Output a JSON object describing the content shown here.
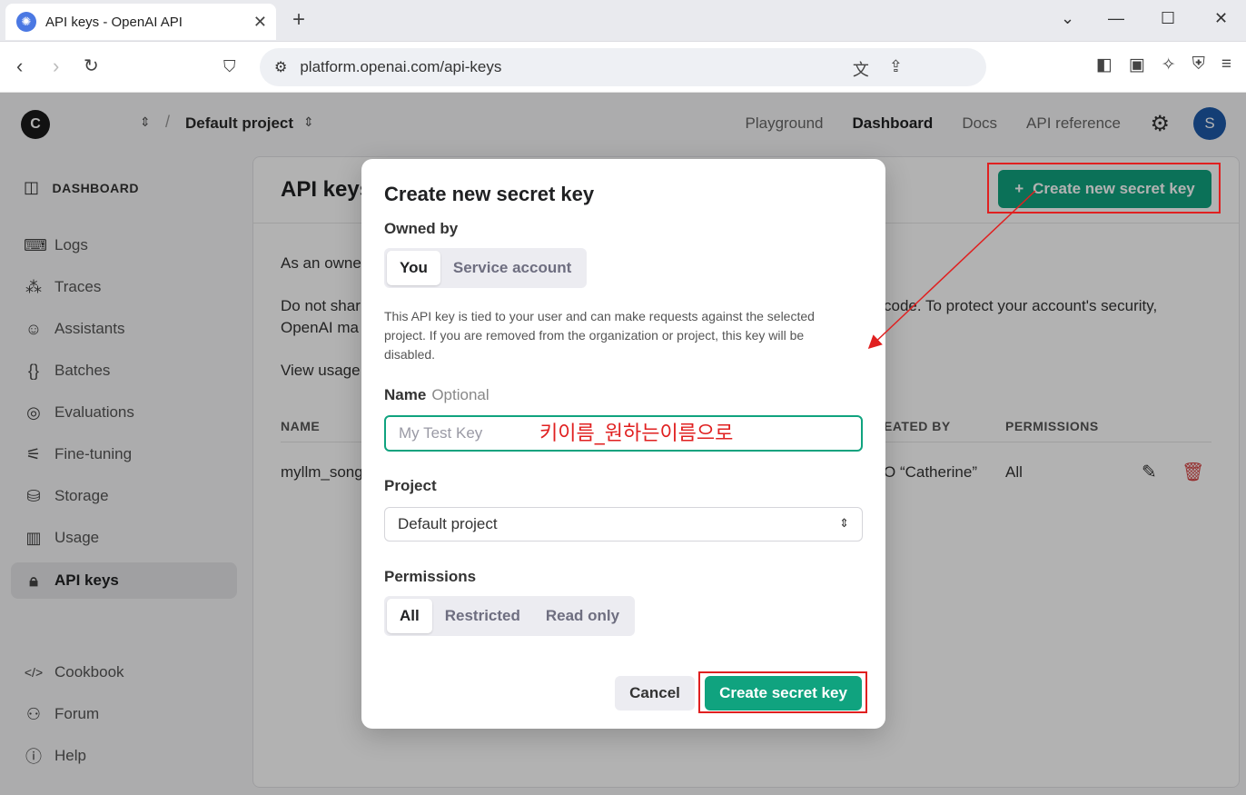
{
  "browser": {
    "tab_title": "API keys - OpenAI API",
    "url": "platform.openai.com/api-keys"
  },
  "topnav": {
    "org_initial": "C",
    "project_name": "Default project",
    "links": [
      "Playground",
      "Dashboard",
      "Docs",
      "API reference"
    ],
    "active_link": "Dashboard",
    "user_initial": "S"
  },
  "sidebar": {
    "header": "DASHBOARD",
    "items": [
      {
        "label": "Logs",
        "icon": "terminal-icon"
      },
      {
        "label": "Traces",
        "icon": "traces-icon"
      },
      {
        "label": "Assistants",
        "icon": "robot-icon"
      },
      {
        "label": "Batches",
        "icon": "braces-icon"
      },
      {
        "label": "Evaluations",
        "icon": "compass-icon"
      },
      {
        "label": "Fine-tuning",
        "icon": "sliders-icon"
      },
      {
        "label": "Storage",
        "icon": "database-icon"
      },
      {
        "label": "Usage",
        "icon": "bar-chart-icon"
      },
      {
        "label": "API keys",
        "icon": "lock-icon"
      }
    ],
    "active_item": "API keys",
    "footer": [
      {
        "label": "Cookbook",
        "icon": "code-icon"
      },
      {
        "label": "Forum",
        "icon": "people-icon"
      },
      {
        "label": "Help",
        "icon": "help-icon"
      }
    ]
  },
  "main": {
    "title": "API keys",
    "create_button": "Create new secret key",
    "para1": "As an owne",
    "para2a": "Do not shar",
    "para2b": "code. To protect your account's security,",
    "para2c": "OpenAI ma",
    "para3": "View usage",
    "columns": [
      "NAME",
      "EATED BY",
      "PERMISSIONS"
    ],
    "row": {
      "name": "myllm_song",
      "created_by": "O “Catherine”",
      "permissions": "All"
    }
  },
  "modal": {
    "title": "Create new secret key",
    "owned_by_label": "Owned by",
    "owned_by_options": [
      "You",
      "Service account"
    ],
    "owned_by_selected": "You",
    "help_text": "This API key is tied to your user and can make requests against the selected project. If you are removed from the organization or project, this key will be disabled.",
    "name_label": "Name",
    "name_optional": "Optional",
    "name_placeholder": "My Test Key",
    "name_value": "",
    "project_label": "Project",
    "project_value": "Default project",
    "permissions_label": "Permissions",
    "permissions_options": [
      "All",
      "Restricted",
      "Read only"
    ],
    "permissions_selected": "All",
    "cancel": "Cancel",
    "submit": "Create secret key"
  },
  "annotation": {
    "text": "키이름_원하는이름으로",
    "color": "#e02020"
  },
  "colors": {
    "accent": "#10a37f",
    "annotation_red": "#e02020"
  }
}
